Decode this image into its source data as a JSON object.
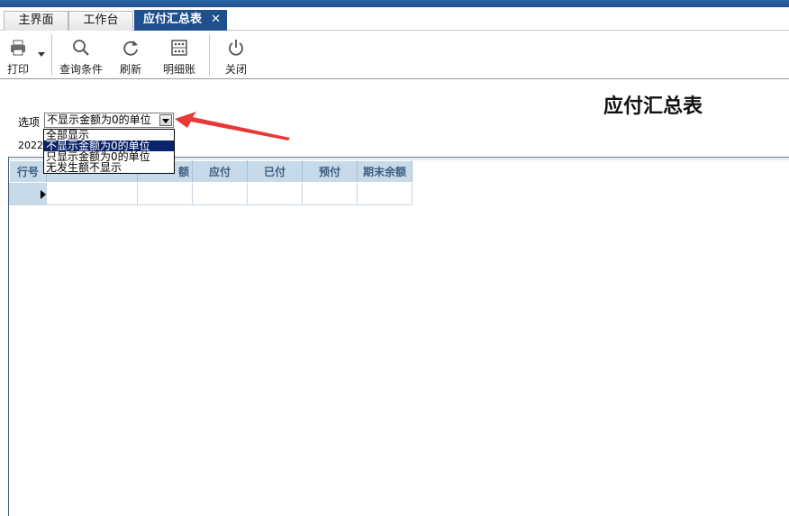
{
  "tabs": [
    {
      "label": "主界面",
      "active": false
    },
    {
      "label": "工作台",
      "active": false
    },
    {
      "label": "应付汇总表",
      "active": true,
      "close": "✕"
    }
  ],
  "toolbar": {
    "print": "打印",
    "query": "查询条件",
    "refresh": "刷新",
    "detail": "明细账",
    "close": "关闭"
  },
  "page_title": "应付汇总表",
  "option": {
    "label": "选项",
    "selected": "不显示金额为0的单位",
    "items": [
      "全部显示",
      "不显示金额为0的单位",
      "只显示金额为0的单位",
      "无发生额不显示"
    ]
  },
  "date_prefix": "2022-",
  "grid": {
    "columns": [
      "行号",
      "",
      "额",
      "应付",
      "已付",
      "预付",
      "期末余额"
    ]
  },
  "colors": {
    "tab_active": "#1f4f8c",
    "grid_header": "#c7daea",
    "dropdown_selected": "#0a246a",
    "annotation_arrow": "#e83838"
  }
}
